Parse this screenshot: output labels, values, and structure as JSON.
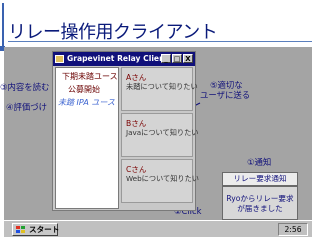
{
  "slide": {
    "title": "リレー操作用クライアント"
  },
  "window": {
    "title": "Grapevinet Relay Client",
    "buttons": {
      "minimize": "_",
      "maximize": "□",
      "close": "X"
    }
  },
  "left_pane": {
    "items": [
      {
        "label": "下期未踏ユース"
      },
      {
        "label": "公募開始"
      },
      {
        "label": "未踏 IPA ユース"
      }
    ]
  },
  "cards": [
    {
      "name": "Aさん",
      "desc": "未踏について知りたい"
    },
    {
      "name": "Bさん",
      "desc": "Javaについて知りたい"
    },
    {
      "name": "Cさん",
      "desc": "Webについて知りたい"
    }
  ],
  "annotations": {
    "read": "③内容を読む",
    "rate": "④評価づけ",
    "forward_line1": "⑤適切な",
    "forward_line2": "ユーザに送る",
    "notify": "①通知",
    "click": "②Click"
  },
  "notification": {
    "header": "リレー要求通知",
    "line1": "Ryoからリレー要求",
    "line2": "が届きました"
  },
  "taskbar": {
    "start_label": "スタート",
    "clock": "2:56"
  },
  "colors": {
    "title": "#0a1a7a",
    "titlebar": "#10107a",
    "accent_dark_red": "#6a0000",
    "stage_gray": "#a4a4a4"
  }
}
